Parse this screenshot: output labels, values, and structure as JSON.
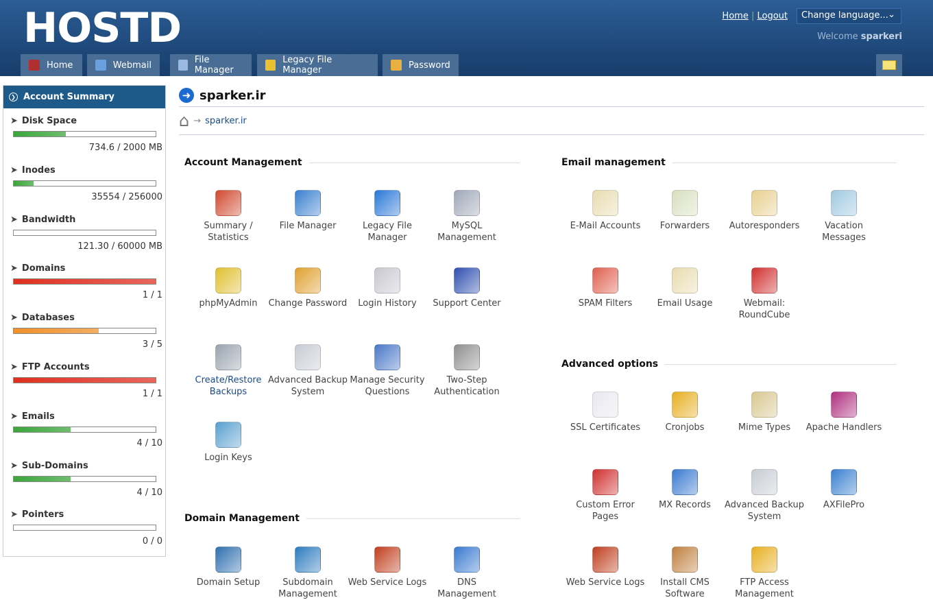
{
  "header": {
    "logo": "HOSTD",
    "links": {
      "home": "Home",
      "sep": "|",
      "logout": "Logout"
    },
    "language": "Change language...",
    "welcome": "Welcome",
    "username": "sparkeri",
    "tabs": [
      {
        "label": "Home",
        "color": "#b03030"
      },
      {
        "label": "Webmail",
        "color": "#6aa0e0"
      },
      {
        "label": "File Manager",
        "color": "#9ab8e0"
      },
      {
        "label": "Legacy File Manager",
        "color": "#e8c030"
      },
      {
        "label": "Password",
        "color": "#e8b040"
      }
    ]
  },
  "sidebar": {
    "title": "Account Summary",
    "items": [
      {
        "label": "Disk Space",
        "value": "734.6 / 2000 MB",
        "percent": 36.7,
        "color": "#3aa63a"
      },
      {
        "label": "Inodes",
        "value": "35554 / 256000",
        "percent": 13.9,
        "color": "#3aa63a"
      },
      {
        "label": "Bandwidth",
        "value": "121.30 / 60000 MB",
        "percent": 0.2,
        "color": "#3aa63a"
      },
      {
        "label": "Domains",
        "value": "1 / 1",
        "percent": 100,
        "color": "#e03020"
      },
      {
        "label": "Databases",
        "value": "3 / 5",
        "percent": 60,
        "color": "#f0902a"
      },
      {
        "label": "FTP Accounts",
        "value": "1 / 1",
        "percent": 100,
        "color": "#e03020"
      },
      {
        "label": "Emails",
        "value": "4 / 10",
        "percent": 40,
        "color": "#3aa63a"
      },
      {
        "label": "Sub-Domains",
        "value": "4 / 10",
        "percent": 40,
        "color": "#3aa63a"
      },
      {
        "label": "Pointers",
        "value": "0 / 0",
        "percent": 0,
        "color": "#3aa63a"
      }
    ]
  },
  "main": {
    "title": "sparker.ir",
    "breadcrumb": "sparker.ir",
    "sections": [
      {
        "title": "Account Management",
        "items": [
          {
            "label": "Summary / Statistics",
            "color": "#d04a30"
          },
          {
            "label": "File Manager",
            "color": "#3a80d0"
          },
          {
            "label": "Legacy File Manager",
            "color": "#2a78d8"
          },
          {
            "label": "MySQL Management",
            "color": "#a0a8b8"
          },
          {
            "label": "phpMyAdmin",
            "color": "#e0c030"
          },
          {
            "label": "Change Password",
            "color": "#e0a030"
          },
          {
            "label": "Login History",
            "color": "#c8c8d0"
          },
          {
            "label": "Support Center",
            "color": "#3050b0"
          },
          {
            "label": "Create/Restore Backups",
            "color": "#9aa4b0",
            "link": true
          },
          {
            "label": "Advanced Backup System",
            "color": "#c8ccd4"
          },
          {
            "label": "Manage Security Questions",
            "color": "#4a78c8"
          },
          {
            "label": "Two-Step Authentication",
            "color": "#909090"
          },
          {
            "label": "Login Keys",
            "color": "#5aa0d0"
          }
        ]
      },
      {
        "title": "Domain Management",
        "items": [
          {
            "label": "Domain Setup",
            "color": "#3070b0"
          },
          {
            "label": "Subdomain Management",
            "color": "#2e7cc0"
          },
          {
            "label": "Web Service Logs",
            "color": "#c04020"
          },
          {
            "label": "DNS Management",
            "color": "#3a7ad0"
          }
        ]
      },
      {
        "title": "Email management",
        "items": [
          {
            "label": "E-Mail Accounts",
            "color": "#e8dcb0"
          },
          {
            "label": "Forwarders",
            "color": "#d8e0c0"
          },
          {
            "label": "Autoresponders",
            "color": "#e8d090"
          },
          {
            "label": "Vacation Messages",
            "color": "#a0c8e0"
          },
          {
            "label": "SPAM Filters",
            "color": "#e06050"
          },
          {
            "label": "Email Usage",
            "color": "#e8dcb0"
          },
          {
            "label": "Webmail: RoundCube",
            "color": "#d03030"
          }
        ]
      },
      {
        "title": "Advanced options",
        "items": [
          {
            "label": "SSL Certificates",
            "color": "#e8e8f0"
          },
          {
            "label": "Cronjobs",
            "color": "#e8b020"
          },
          {
            "label": "Mime Types",
            "color": "#d8c890"
          },
          {
            "label": "Apache Handlers",
            "color": "#b03080"
          },
          {
            "label": "Custom Error Pages",
            "color": "#d03030"
          },
          {
            "label": "MX Records",
            "color": "#3a7ad0"
          },
          {
            "label": "Advanced Backup System",
            "color": "#c8ccd4"
          },
          {
            "label": "AXFilePro",
            "color": "#3a80d0"
          },
          {
            "label": "Web Service Logs",
            "color": "#c04020"
          },
          {
            "label": "Install CMS Software",
            "color": "#c08040"
          },
          {
            "label": "FTP Access Management",
            "color": "#e8b020"
          }
        ]
      }
    ]
  }
}
